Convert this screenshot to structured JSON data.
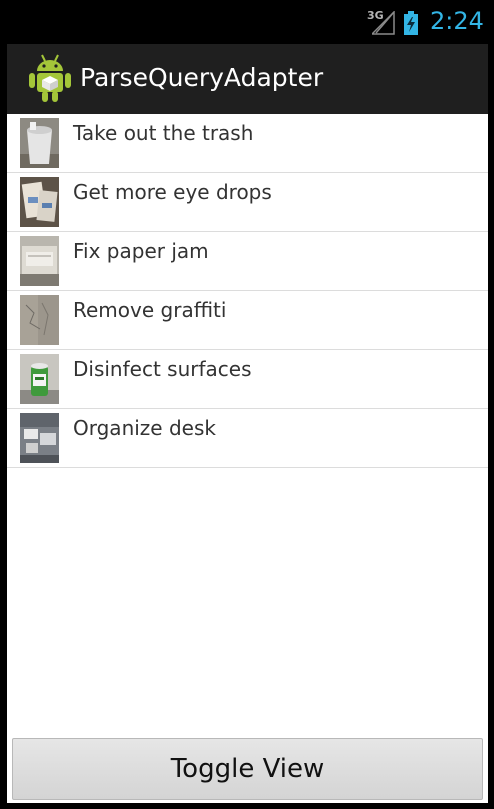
{
  "status_bar": {
    "network_type": "3G",
    "signal_icon": "signal-icon",
    "battery_icon": "battery-charging-icon",
    "time": "2:24",
    "time_color": "#33b5e5"
  },
  "action_bar": {
    "icon": "android-robot-icon",
    "title": "ParseQueryAdapter"
  },
  "list": {
    "items": [
      {
        "label": "Take out the trash"
      },
      {
        "label": "Get more eye drops"
      },
      {
        "label": "Fix paper jam"
      },
      {
        "label": "Remove graffiti"
      },
      {
        "label": "Disinfect surfaces"
      },
      {
        "label": "Organize desk"
      }
    ]
  },
  "footer": {
    "toggle_label": "Toggle View"
  }
}
